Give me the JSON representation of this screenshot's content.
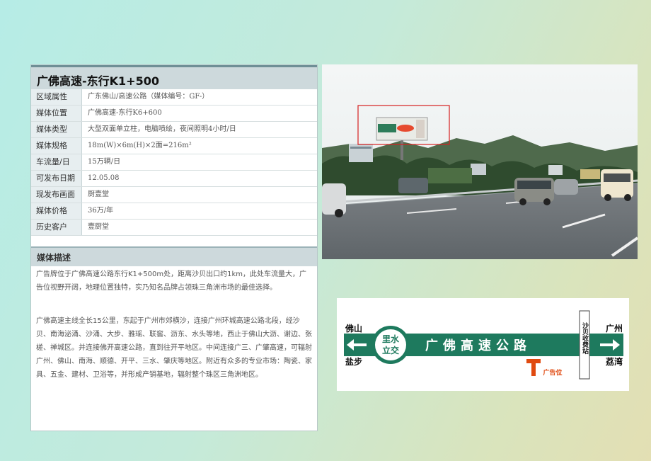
{
  "title": "广佛高速-东行K1+500",
  "rows": [
    {
      "label": "区域属性",
      "value": "广东佛山/高速公路（媒体编号：GF-）"
    },
    {
      "label": "媒体位置",
      "value": "广佛高速-东行K6+600"
    },
    {
      "label": "媒体类型",
      "value": "大型双面单立柱，电脑喷绘，夜间照明4小时/日"
    },
    {
      "label": "媒体规格",
      "value": "18m(W)×6m(H)×2面=216m²"
    },
    {
      "label": "车流量/日",
      "value": "15万辆/日"
    },
    {
      "label": "可发布日期",
      "value": "12.05.08"
    },
    {
      "label": "现发布画面",
      "value": "厨壹堂"
    },
    {
      "label": "媒体价格",
      "value": "36万/年"
    },
    {
      "label": "历史客户",
      "value": "壹厨堂"
    }
  ],
  "description": {
    "title": "媒体描述",
    "para1": "广告牌位于广佛高速公路东行K1+500m处，距离沙贝出口约1km，此处车流量大，广告位视野开阔，地理位置独特，实乃知名品牌占领珠三角洲市场的最佳选择。",
    "para2": "广佛高速主线全长15公里，东起于广州市郊横沙，连接广州环城高速公路北段，经沙贝、南海泌涌、沙涌、大步、雅瑶、联窖、沥东、水头等地，西止于佛山大沥、谢边、张槎、禅城区。并连接佛开高速公路，直到往开平地区。中间连接广三、广肇高速，可辐射广州、佛山、南海、顺德、开平、三水、肇庆等地区。附近有众多的专业市场：陶瓷、家具、五金、建材、卫浴等，并形成产销基地，辐射整个珠区三角洲地区。"
  },
  "map": {
    "left_top": "佛山",
    "left_bottom": "盐步",
    "interchange": [
      "里水",
      "立交"
    ],
    "road": "广佛高速公路",
    "toll": "沙贝收费站",
    "right_top": "广州",
    "right_bottom": "荔湾",
    "marker_label": "广告位",
    "colors": {
      "road": "#1e7a5e",
      "marker": "#e04a10"
    }
  }
}
